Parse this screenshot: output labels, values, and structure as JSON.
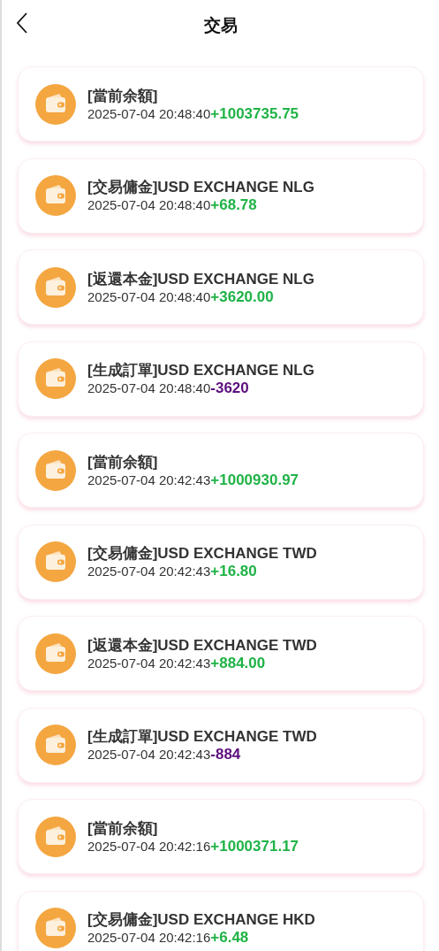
{
  "header": {
    "title": "交易"
  },
  "transactions": [
    {
      "title": "[當前余額]",
      "time": "2025-07-04 20:48:40",
      "amount": "+1003735.75",
      "color": "#1fb346"
    },
    {
      "title": "[交易傭金]USD EXCHANGE NLG",
      "time": "2025-07-04 20:48:40",
      "amount": "+68.78",
      "color": "#1fb346"
    },
    {
      "title": "[返還本金]USD EXCHANGE NLG",
      "time": "2025-07-04 20:48:40",
      "amount": "+3620.00",
      "color": "#1fb346"
    },
    {
      "title": "[生成訂單]USD EXCHANGE NLG",
      "time": "2025-07-04 20:48:40",
      "amount": "-3620",
      "color": "#5c0f7d"
    },
    {
      "title": "[當前余額]",
      "time": "2025-07-04 20:42:43",
      "amount": "+1000930.97",
      "color": "#1fb346"
    },
    {
      "title": "[交易傭金]USD EXCHANGE TWD",
      "time": "2025-07-04 20:42:43",
      "amount": "+16.80",
      "color": "#1fb346"
    },
    {
      "title": "[返還本金]USD EXCHANGE TWD",
      "time": "2025-07-04 20:42:43",
      "amount": "+884.00",
      "color": "#1fb346"
    },
    {
      "title": "[生成訂單]USD EXCHANGE TWD",
      "time": "2025-07-04 20:42:43",
      "amount": "-884",
      "color": "#5c0f7d"
    },
    {
      "title": "[當前余額]",
      "time": "2025-07-04 20:42:16",
      "amount": "+1000371.17",
      "color": "#1fb346"
    },
    {
      "title": "[交易傭金]USD EXCHANGE HKD",
      "time": "2025-07-04 20:42:16",
      "amount": "+6.48",
      "color": "#1fb346"
    }
  ]
}
